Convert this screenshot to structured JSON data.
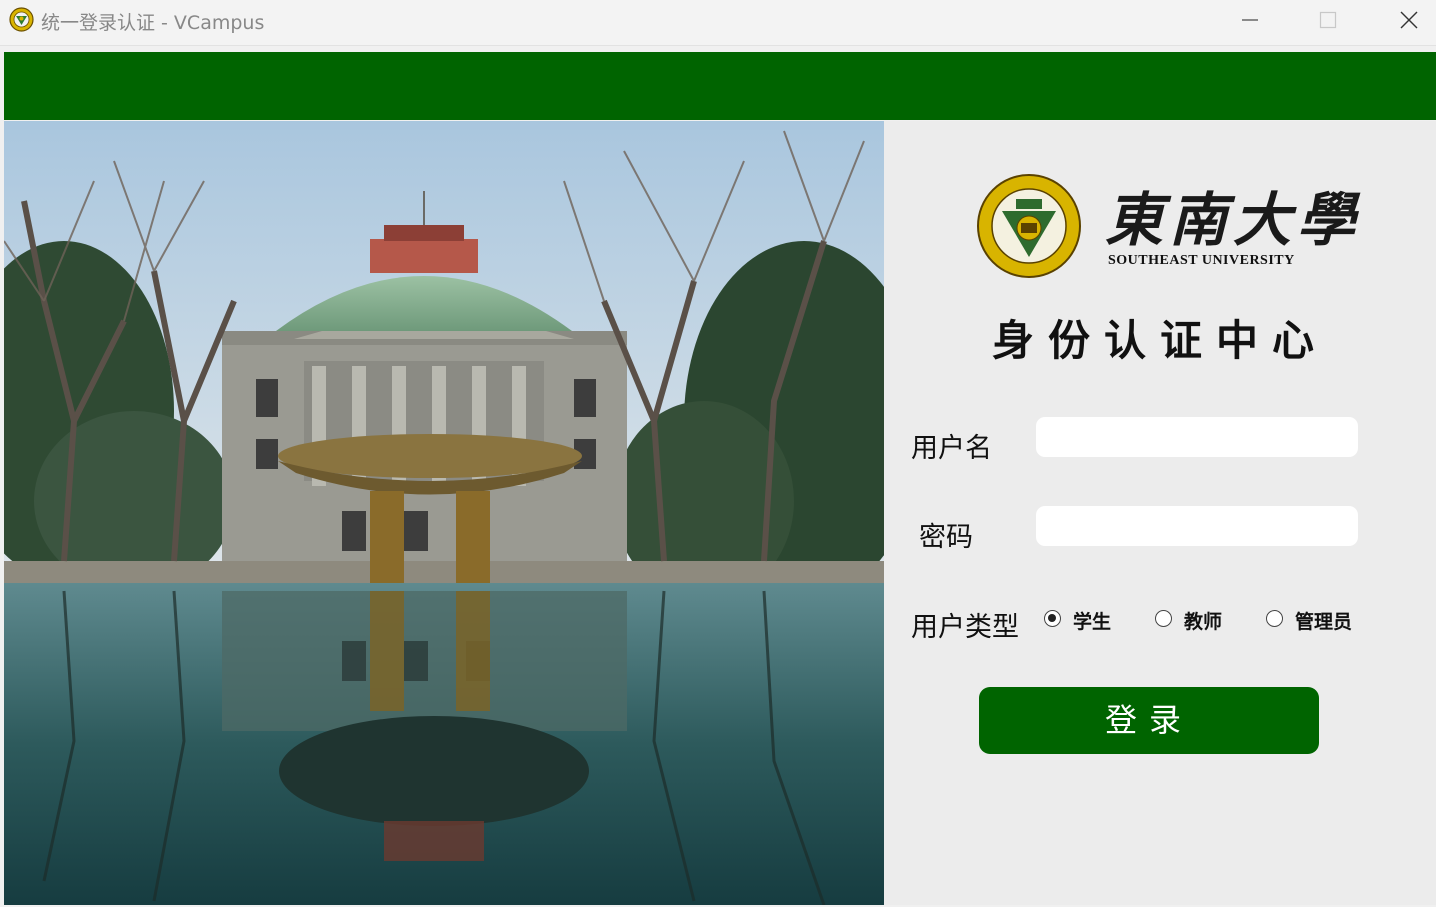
{
  "window": {
    "title": "统一登录认证 - VCampus",
    "icon": "university-seal-icon",
    "controls": [
      "minimize-icon",
      "maximize-icon",
      "close-icon"
    ]
  },
  "colors": {
    "brand_green": "#006400",
    "panel_bg": "#ececec",
    "field_bg": "#ffffff"
  },
  "logo": {
    "chinese_name": "東南大學",
    "english_name": "SOUTHEAST UNIVERSITY"
  },
  "form": {
    "heading": "身份认证中心",
    "username_label": "用户名",
    "username_value": "",
    "password_label": "密码",
    "password_value": "",
    "user_type_label": "用户类型",
    "user_types": [
      {
        "label": "学生",
        "checked": true
      },
      {
        "label": "教师",
        "checked": false
      },
      {
        "label": "管理员",
        "checked": false
      }
    ],
    "login_label": "登录"
  }
}
